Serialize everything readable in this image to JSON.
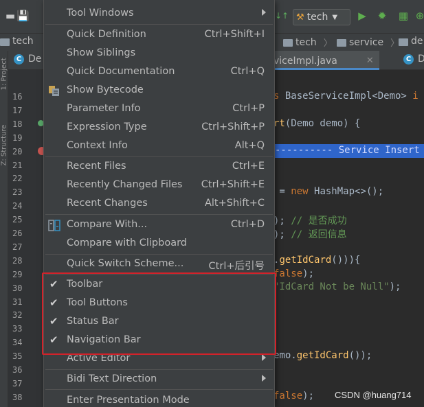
{
  "toolbar": {
    "run_config": "tech",
    "icons": [
      "save-icon",
      "build-icon",
      "run-icon",
      "debug-icon",
      "coverage-icon"
    ]
  },
  "breadcrumbs": {
    "left": "tech",
    "right": [
      {
        "label": "tech"
      },
      {
        "label": "service"
      },
      {
        "label": "de"
      }
    ]
  },
  "tabs": [
    {
      "label": "De",
      "active": false
    },
    {
      "label": "viceImpl.java",
      "active": true
    },
    {
      "label": "D",
      "active": false
    }
  ],
  "side_panel": {
    "project": "1: Project",
    "structure": "Z: Structure"
  },
  "editor": {
    "line_numbers": [
      "16",
      "17",
      "18",
      "19",
      "20",
      "21",
      "22",
      "23",
      "24",
      "25",
      "26",
      "27",
      "28",
      "29",
      "30",
      "31",
      "32",
      "33",
      "34",
      "35",
      "36",
      "37",
      "38"
    ],
    "code": {
      "l16a": "s ",
      "l16b": "BaseServiceImpl<Demo>",
      "l16c": " i",
      "l18a": "rt",
      "l18b": "(Demo demo) {",
      "l20": "---------- Service Insert",
      "l23a": " = ",
      "l23b": "new ",
      "l23c": "HashMap<>();",
      "l25a": "); ",
      "l25b": "// 是否成功",
      "l26a": "); ",
      "l26b": "// 返回信息",
      "l28a": ".",
      "l28b": "getIdCard",
      "l28c": "())){",
      "l29a": "false",
      "l29b": ");",
      "l30a": "\"IdCard Not be Null\"",
      "l30b": ");",
      "l35a": "emo.",
      "l35b": "getIdCard",
      "l35c": "());",
      "l38a": "false",
      "l38b": ");"
    }
  },
  "menu": {
    "tool_windows": "Tool Windows",
    "quick_definition": "Quick Definition",
    "quick_definition_sc": "Ctrl+Shift+I",
    "show_siblings": "Show Siblings",
    "quick_documentation": "Quick Documentation",
    "quick_documentation_sc": "Ctrl+Q",
    "show_bytecode": "Show Bytecode",
    "parameter_info": "Parameter Info",
    "parameter_info_sc": "Ctrl+P",
    "expression_type": "Expression Type",
    "expression_type_sc": "Ctrl+Shift+P",
    "context_info": "Context Info",
    "context_info_sc": "Alt+Q",
    "recent_files": "Recent Files",
    "recent_files_sc": "Ctrl+E",
    "recently_changed_files": "Recently Changed Files",
    "recently_changed_files_sc": "Ctrl+Shift+E",
    "recent_changes": "Recent Changes",
    "recent_changes_sc": "Alt+Shift+C",
    "compare_with": "Compare With...",
    "compare_with_sc": "Ctrl+D",
    "compare_with_clipboard": "Compare with Clipboard",
    "quick_switch_scheme": "Quick Switch Scheme...",
    "quick_switch_scheme_sc": "Ctrl+后引号",
    "toolbar": "Toolbar",
    "toolbar_checked": true,
    "tool_buttons": "Tool Buttons",
    "tool_buttons_checked": true,
    "status_bar": "Status Bar",
    "status_bar_checked": true,
    "navigation_bar": "Navigation Bar",
    "navigation_bar_checked": true,
    "active_editor": "Active Editor",
    "bidi_text_direction": "Bidi Text Direction",
    "enter_presentation_mode": "Enter Presentation Mode"
  },
  "watermark": "CSDN @huang714",
  "colors": {
    "menu_bg": "#3c3f41",
    "editor_bg": "#2b2b2b",
    "highlight_box": "#d3222a",
    "selection_line": "#2f65ca"
  }
}
